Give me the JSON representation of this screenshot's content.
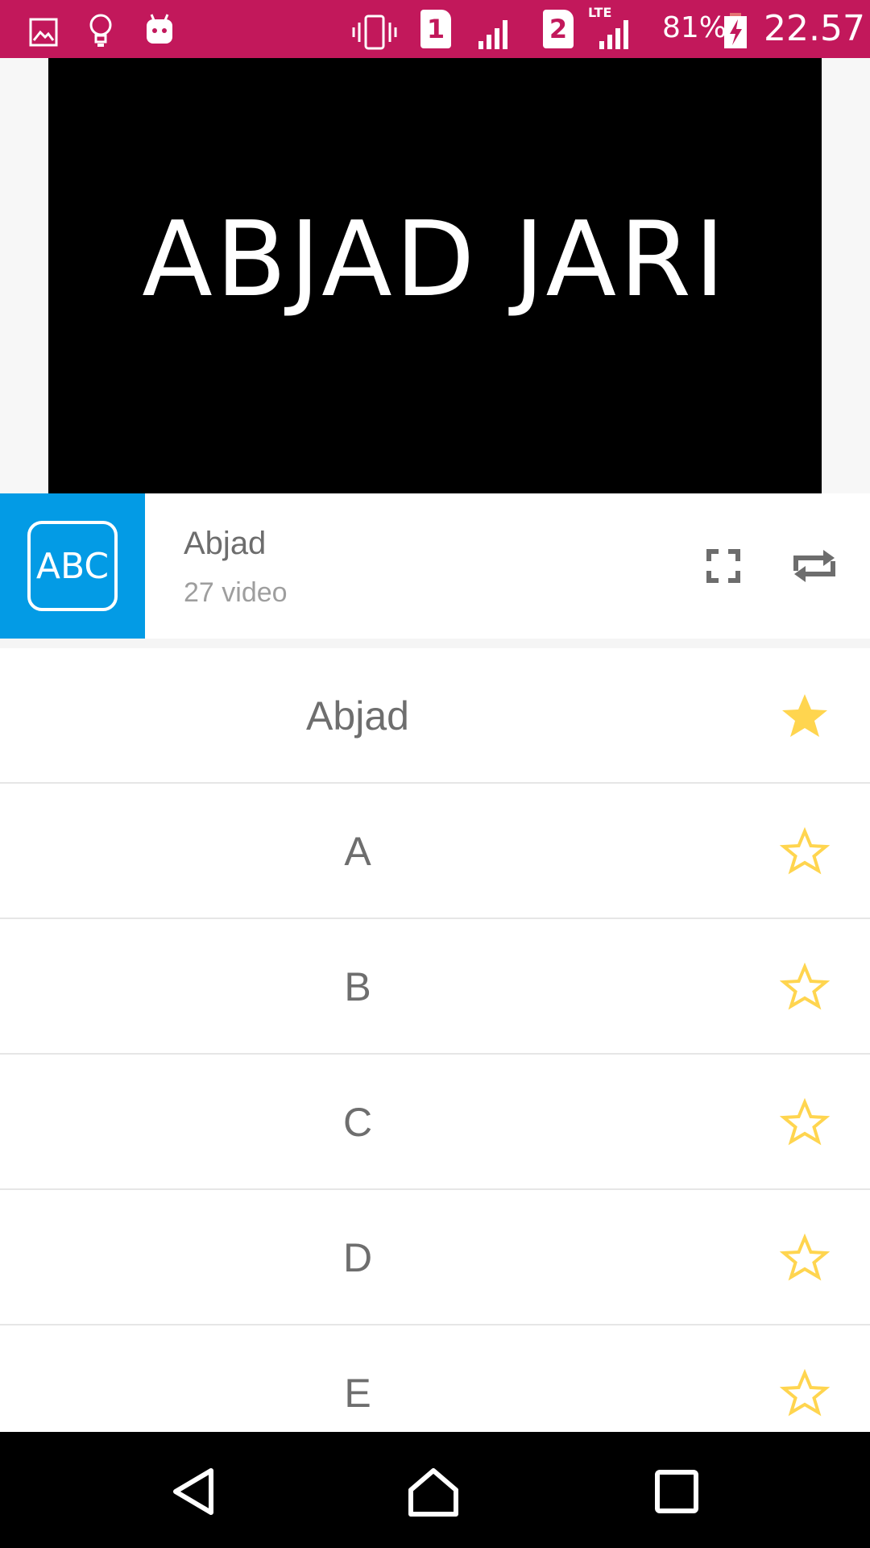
{
  "status_bar": {
    "battery_percent": "81%",
    "time": "22.57",
    "sim1_label": "1",
    "sim2_label": "2",
    "network_type": "LTE",
    "background_color": "#c2185b"
  },
  "video": {
    "title_text": "ABJAD JARI"
  },
  "playlist": {
    "thumb_text": "ABC",
    "thumb_color": "#039be5",
    "title": "Abjad",
    "count": "27 video"
  },
  "list": {
    "star_color": "#ffd54f",
    "items": [
      {
        "label": "Abjad",
        "favorite": true
      },
      {
        "label": "A",
        "favorite": false
      },
      {
        "label": "B",
        "favorite": false
      },
      {
        "label": "C",
        "favorite": false
      },
      {
        "label": "D",
        "favorite": false
      },
      {
        "label": "E",
        "favorite": false
      }
    ]
  },
  "icons": {
    "status": [
      "image-icon",
      "lightbulb-icon",
      "android-icon",
      "vibrate-icon",
      "sim1-icon",
      "signal-icon",
      "sim2-icon",
      "signal-lte-icon",
      "battery-charging-icon"
    ],
    "header": [
      "fullscreen-icon",
      "repeat-icon"
    ],
    "nav": [
      "back-icon",
      "home-icon",
      "recents-icon"
    ]
  }
}
